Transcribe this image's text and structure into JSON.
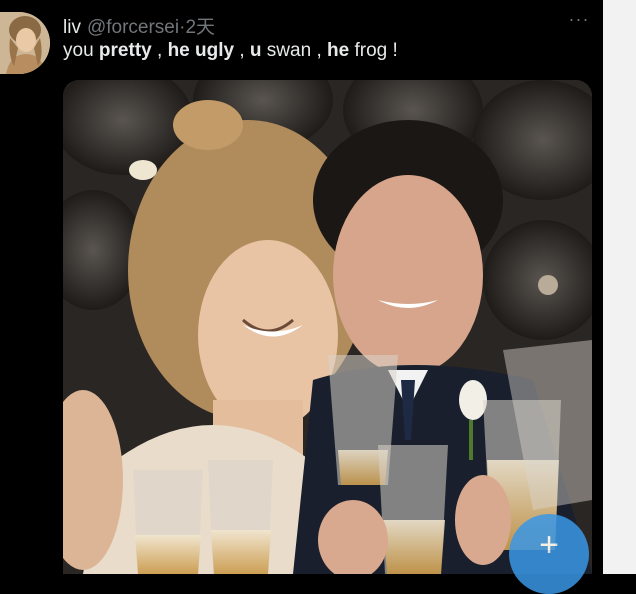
{
  "post": {
    "display_name": "liv",
    "handle": "@forcersei",
    "separator": "·",
    "time": "2天",
    "more": "···",
    "text_parts": [
      {
        "t": "you ",
        "bold": false
      },
      {
        "t": "pretty",
        "bold": true
      },
      {
        "t": " , ",
        "bold": false
      },
      {
        "t": "he ugly",
        "bold": true
      },
      {
        "t": " , ",
        "bold": false
      },
      {
        "t": "u",
        "bold": true
      },
      {
        "t": " swan , ",
        "bold": false
      },
      {
        "t": "he",
        "bold": true
      },
      {
        "t": " frog !",
        "bold": false
      }
    ]
  },
  "compose_fab": {
    "glyph": "+"
  },
  "colors": {
    "background": "#000000",
    "text": "#e7e9ea",
    "secondary_text": "#71767b",
    "fab": "#3a97e6"
  }
}
